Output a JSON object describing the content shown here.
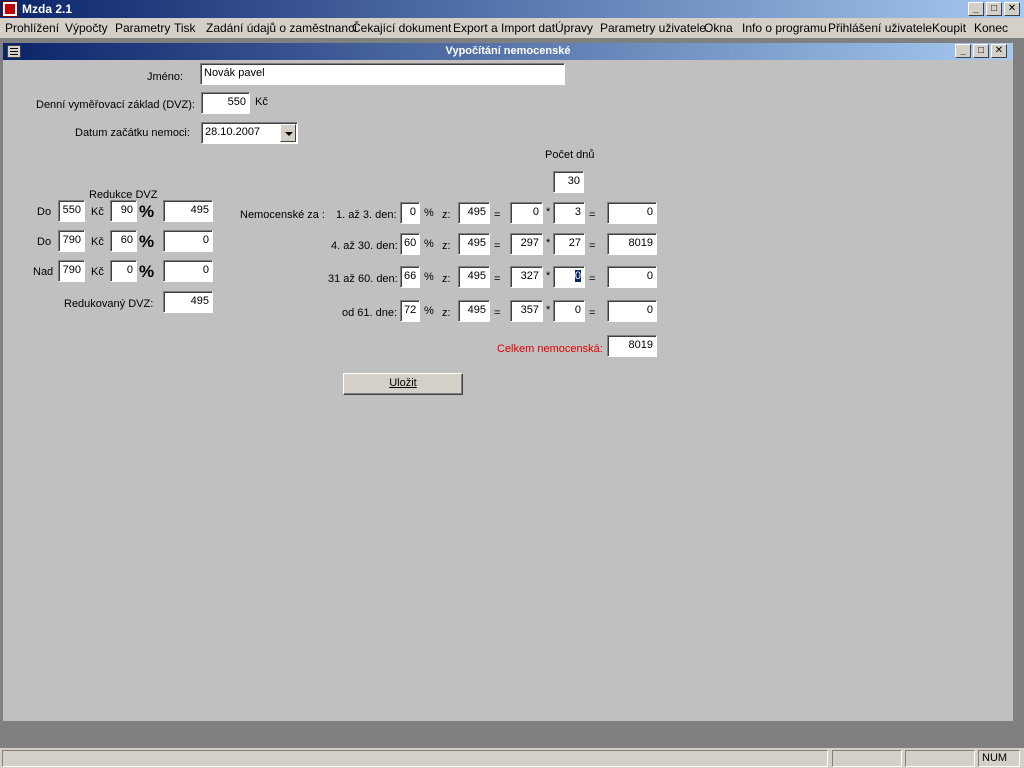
{
  "app": {
    "title": "Mzda 2.1"
  },
  "menu": [
    "Prohlížení",
    "Výpočty",
    "Parametry",
    "Tisk",
    "Zadání údajů o zaměstnanci",
    "Čekající dokument",
    "Export a Import dat",
    "Úpravy",
    "Parametry uživatele",
    "Okna",
    "Info o programu",
    "Přihlášení uživatele",
    "Koupit",
    "Konec"
  ],
  "window": {
    "title": "Vypočítání nemocenské"
  },
  "form": {
    "jmeno_label": "Jméno:",
    "jmeno_value": "Novák pavel",
    "dvz_label": "Denní vyměřovací základ (DVZ):",
    "dvz_value": "550",
    "dvz_unit": "Kč",
    "datum_label": "Datum začátku nemoci:",
    "datum_value": "28.10.2007"
  },
  "reduction": {
    "header": "Redukce DVZ",
    "rows": [
      {
        "prefix": "Do",
        "limit": "550",
        "unit": "Kč",
        "percent": "90",
        "pct_sign": "%",
        "result": "495"
      },
      {
        "prefix": "Do",
        "limit": "790",
        "unit": "Kč",
        "percent": "60",
        "pct_sign": "%",
        "result": "0"
      },
      {
        "prefix": "Nad",
        "limit": "790",
        "unit": "Kč",
        "percent": "0",
        "pct_sign": "%",
        "result": "0"
      }
    ],
    "reduced_label": "Redukovaný DVZ:",
    "reduced_value": "495"
  },
  "sickness": {
    "pocet_dnu_label": "Počet dnů",
    "pocet_dnu_value": "30",
    "title_label": "Nemocenské za :",
    "rows": [
      {
        "label": "1. až 3. den:",
        "pct": "0",
        "pct_sign": "%",
        "z": "z:",
        "base": "495",
        "eq1": "=",
        "rate": "0",
        "mul": "*",
        "days": "3",
        "eq2": "=",
        "total": "0"
      },
      {
        "label": "4. až 30. den:",
        "pct": "60",
        "pct_sign": "%",
        "z": "z:",
        "base": "495",
        "eq1": "=",
        "rate": "297",
        "mul": "*",
        "days": "27",
        "eq2": "=",
        "total": "8019"
      },
      {
        "label": "31 až 60. den:",
        "pct": "66",
        "pct_sign": "%",
        "z": "z:",
        "base": "495",
        "eq1": "=",
        "rate": "327",
        "mul": "*",
        "days": "0",
        "eq2": "=",
        "total": "0"
      },
      {
        "label": "od 61. dne:",
        "pct": "72",
        "pct_sign": "%",
        "z": "z:",
        "base": "495",
        "eq1": "=",
        "rate": "357",
        "mul": "*",
        "days": "0",
        "eq2": "=",
        "total": "0"
      }
    ],
    "celkem_label": "Celkem nemocenská:",
    "celkem_value": "8019"
  },
  "save_button": "Uložit",
  "status": {
    "num": "NUM"
  },
  "colors": {
    "title_gradient_start": "#0a246a",
    "title_gradient_end": "#a6caf0",
    "window_bg": "#c0c0c0",
    "red_label": "#e00000"
  }
}
